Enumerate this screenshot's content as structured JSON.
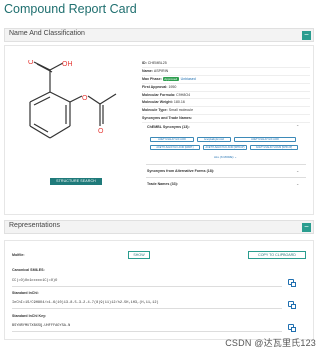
{
  "page": {
    "title": "Compound Report Card"
  },
  "sections": {
    "name_classification": {
      "label": "Name And Classification",
      "toggle": "−"
    },
    "representations": {
      "label": "Representations",
      "toggle": "−"
    }
  },
  "structure": {
    "button_label": "STRUCTURE SEARCH",
    "atoms": {
      "O_carbonyl": "O",
      "OH": "OH",
      "O_ester": "O",
      "O_acetyl": "O"
    },
    "colors": {
      "bond": "#333333",
      "oxygen": "#e53935"
    }
  },
  "properties": [
    {
      "key": "ID:",
      "value": "CHEMBL25"
    },
    {
      "key": "Name:",
      "value": "ASPIRIN"
    },
    {
      "key": "Max Phase:",
      "badge": "Approved",
      "link": "Unbiased"
    },
    {
      "key": "First Approval:",
      "value": "1950"
    },
    {
      "key": "Molecular Formula:",
      "value": "C9H8O4"
    },
    {
      "key": "Molecular Weight:",
      "value": "180.16"
    },
    {
      "key": "Molecule Type:",
      "value": "Small molecule"
    },
    {
      "key": "Synonyms and Trade Names:",
      "value": ""
    }
  ],
  "synonyms": {
    "chembl_header": "ChEMBL Synonyms (13):",
    "chips": [
      "ACETYLSALICYLIC ACID",
      "Acetylsalicylic Acid",
      "ACETYLSALICYLIC ACID",
      "ACETYLSALICYLIC ACID (MART.)",
      "ACETYLSALICYLIC ACID (WHO-IP)",
      "ACETYLSALICYLICUM [WHO-IP]"
    ],
    "all_more": "ALL (6 MORE) ⌄",
    "alt_forms": "Synonyms from Alternative Forms (18):",
    "trade_names": "Trade Names (33):"
  },
  "representations": {
    "molfile_label": "Molfile:",
    "show_button": "SHOW",
    "copy_button": "COPY TO CLIPBOARD",
    "smiles_label": "Canonical SMILES:",
    "smiles_value": "CC(=O)Oc1ccccc1C(=O)O",
    "inchi_label": "Standard InChI:",
    "inchi_value": "InChI=1S/C9H8O4/c1-6(10)13-8-5-3-2-4-7(8)9(11)12/h2-5H,1H3,(H,11,12)",
    "inchikey_label": "Standard InChI Key:",
    "inchikey_value": "BSYNRYMUTXBXSQ-UHFFFAOYSA-N"
  },
  "watermark": "CSDN @达瓦里氏123",
  "colors": {
    "accent": "#2a9d8f",
    "approved": "#2e9e4f",
    "link": "#1f6fb0"
  }
}
